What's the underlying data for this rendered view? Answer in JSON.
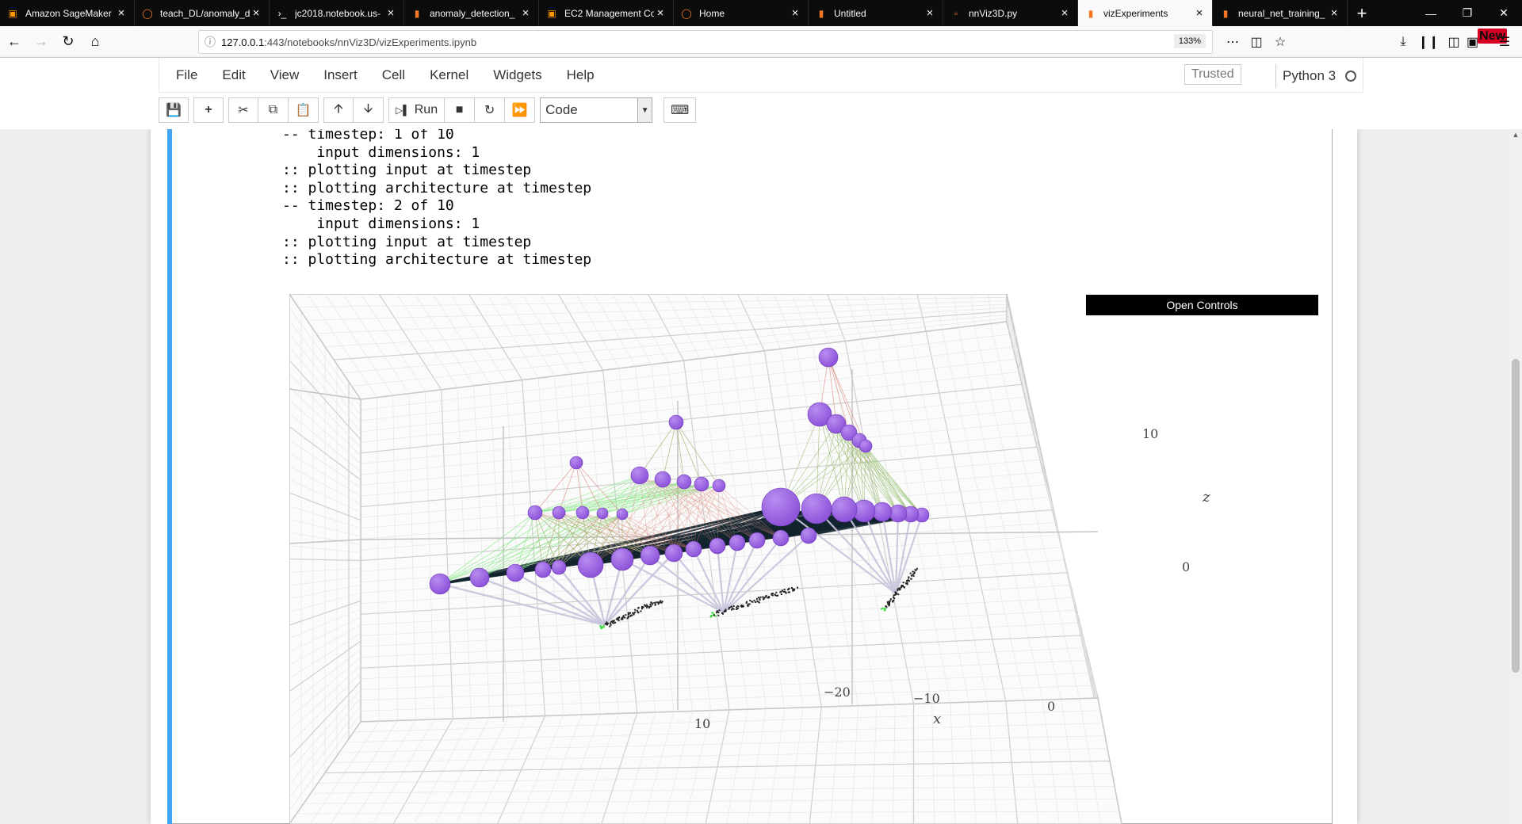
{
  "browser": {
    "tabs": [
      {
        "label": "Amazon SageMaker",
        "icon": "aws-box-icon",
        "active": false
      },
      {
        "label": "teach_DL/anomaly_d",
        "icon": "jupyter-icon",
        "active": false
      },
      {
        "label": "jc2018.notebook.us-",
        "icon": "terminal-icon",
        "active": false
      },
      {
        "label": "anomaly_detection_",
        "icon": "notebook-icon",
        "active": false
      },
      {
        "label": "EC2 Management Co",
        "icon": "aws-box-icon",
        "active": false
      },
      {
        "label": "Home",
        "icon": "jupyter-icon",
        "active": false
      },
      {
        "label": "Untitled",
        "icon": "notebook-icon",
        "active": false
      },
      {
        "label": "nnViz3D.py",
        "icon": "file-icon",
        "active": false
      },
      {
        "label": "vizExperiments",
        "icon": "notebook-icon",
        "active": true
      },
      {
        "label": "neural_net_training_",
        "icon": "notebook-icon",
        "active": false
      }
    ],
    "url_host": "127.0.0.1",
    "url_path": ":443/notebooks/nnViz3D/vizExperiments.ipynb",
    "zoom": "133%",
    "new_badge": "New"
  },
  "jupyter": {
    "menu": [
      "File",
      "Edit",
      "View",
      "Insert",
      "Cell",
      "Kernel",
      "Widgets",
      "Help"
    ],
    "trusted": "Trusted",
    "kernel_name": "Python 3",
    "run_label": "Run",
    "cell_type": "Code"
  },
  "output_lines": [
    "-- timestep: 1 of 10",
    "    input dimensions: 1",
    ":: plotting input at timestep",
    ":: plotting architecture at timestep",
    "-- timestep: 2 of 10",
    "    input dimensions: 1",
    ":: plotting input at timestep",
    ":: plotting architecture at timestep"
  ],
  "plot": {
    "open_controls": "Open Controls",
    "z_ticks": [
      "10",
      "0"
    ],
    "x_ticks": [
      "−20",
      "−10",
      "0"
    ],
    "y_ticks": [
      "10"
    ],
    "x_title": "x",
    "z_title": "z",
    "colors": {
      "node": "#8a4fd8",
      "node_light": "#b88cf0",
      "bundle": "#12242e",
      "edge_green": "#7de87d",
      "edge_red": "#d9897a",
      "input_lines": "#c8c4dc",
      "input_points": "#33dd33"
    }
  }
}
